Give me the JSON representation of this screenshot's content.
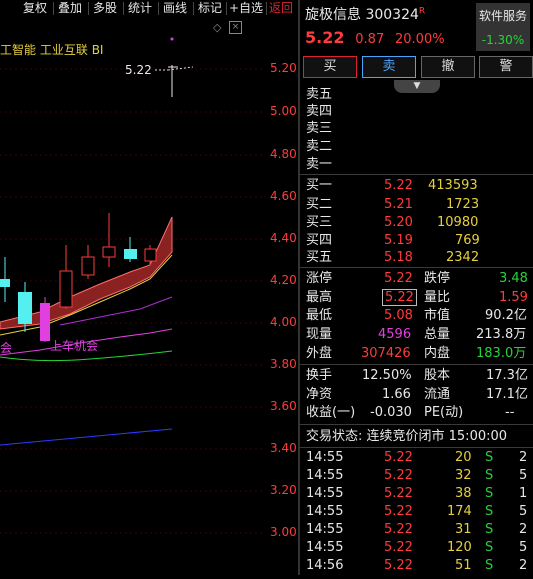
{
  "toolbar": {
    "items": [
      "复权",
      "叠加",
      "多股",
      "统计",
      "画线",
      "标记",
      "+自选",
      "返回"
    ]
  },
  "chart": {
    "legend": [
      "工智能",
      "工业互联",
      "BI"
    ],
    "price_marker": "5.22",
    "axis_labels": [
      "5.20",
      "5.00",
      "4.80",
      "4.60",
      "4.40",
      "4.20",
      "4.00",
      "3.80",
      "3.60",
      "3.40",
      "3.20",
      "3.00"
    ],
    "annotations": [
      "会",
      "上车机会"
    ],
    "colors": {
      "up": "#ff3b3b",
      "down": "#54f0f0",
      "band": "#8a2222",
      "ma_yellow": "#e6d03c",
      "ma_magenta": "#e040e0",
      "ma_green": "#27d23a",
      "ma_blue": "#2b3bff"
    }
  },
  "quote": {
    "name": "旋极信息",
    "code": "300324",
    "flag": "R",
    "price": "5.22",
    "change": "0.87",
    "percent": "20.00%",
    "sector_name": "软件服务",
    "sector_percent": "-1.30%"
  },
  "actions": {
    "buy": "买",
    "sell": "卖",
    "cancel": "撤",
    "alert": "警"
  },
  "sell_book": [
    {
      "label": "卖五",
      "price": "",
      "vol": ""
    },
    {
      "label": "卖四",
      "price": "",
      "vol": ""
    },
    {
      "label": "卖三",
      "price": "",
      "vol": ""
    },
    {
      "label": "卖二",
      "price": "",
      "vol": ""
    },
    {
      "label": "卖一",
      "price": "",
      "vol": ""
    }
  ],
  "buy_book": [
    {
      "label": "买一",
      "price": "5.22",
      "vol": "413593"
    },
    {
      "label": "买二",
      "price": "5.21",
      "vol": "1723"
    },
    {
      "label": "买三",
      "price": "5.20",
      "vol": "10980"
    },
    {
      "label": "买四",
      "price": "5.19",
      "vol": "769"
    },
    {
      "label": "买五",
      "price": "5.18",
      "vol": "2342"
    }
  ],
  "stats1": [
    {
      "l1": "涨停",
      "v1": "5.22",
      "l2": "跌停",
      "v2": "3.48"
    },
    {
      "l1": "最高",
      "v1": "5.22",
      "l2": "量比",
      "v2": "1.59"
    },
    {
      "l1": "最低",
      "v1": "5.08",
      "l2": "市值",
      "v2": "90.2亿"
    },
    {
      "l1": "现量",
      "v1": "4596",
      "l2": "总量",
      "v2": "213.8万"
    },
    {
      "l1": "外盘",
      "v1": "307426",
      "l2": "内盘",
      "v2": "183.0万"
    }
  ],
  "stats2": [
    {
      "l1": "换手",
      "v1": "12.50%",
      "l2": "股本",
      "v2": "17.3亿"
    },
    {
      "l1": "净资",
      "v1": "1.66",
      "l2": "流通",
      "v2": "17.1亿"
    },
    {
      "l1": "收益(一)",
      "v1": "-0.030",
      "l2": "PE(动)",
      "v2": "--"
    }
  ],
  "trade_status": "交易状态: 连续竞价闭市 15:00:00",
  "ticks": [
    {
      "time": "14:55",
      "price": "5.22",
      "vol": "20",
      "dir": "S",
      "n": "2"
    },
    {
      "time": "14:55",
      "price": "5.22",
      "vol": "32",
      "dir": "S",
      "n": "5"
    },
    {
      "time": "14:55",
      "price": "5.22",
      "vol": "38",
      "dir": "S",
      "n": "1"
    },
    {
      "time": "14:55",
      "price": "5.22",
      "vol": "174",
      "dir": "S",
      "n": "5"
    },
    {
      "time": "14:55",
      "price": "5.22",
      "vol": "31",
      "dir": "S",
      "n": "2"
    },
    {
      "time": "14:55",
      "price": "5.22",
      "vol": "120",
      "dir": "S",
      "n": "5"
    },
    {
      "time": "14:56",
      "price": "5.22",
      "vol": "51",
      "dir": "S",
      "n": "2"
    }
  ]
}
